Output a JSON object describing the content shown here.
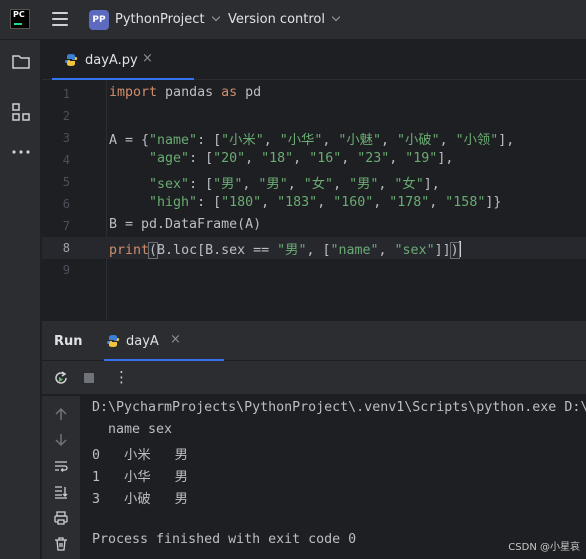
{
  "titlebar": {
    "app_logo": "PC",
    "project_badge": "PP",
    "project_name": "PythonProject",
    "version_control": "Version control"
  },
  "editor": {
    "tab_label": "dayA.py",
    "tab_close": "×",
    "lines": [
      {
        "number": "1",
        "text": "import pandas as pd"
      },
      {
        "number": "2",
        "text": ""
      },
      {
        "number": "3",
        "text": "A = {\"name\": [\"小米\", \"小华\", \"小魅\", \"小破\", \"小领\"],"
      },
      {
        "number": "4",
        "text": "     \"age\": [\"20\", \"18\", \"16\", \"23\", \"19\"],"
      },
      {
        "number": "5",
        "text": "     \"sex\": [\"男\", \"男\", \"女\", \"男\", \"女\"],"
      },
      {
        "number": "6",
        "text": "     \"high\": [\"180\", \"183\", \"160\", \"178\", \"158\"]}"
      },
      {
        "number": "7",
        "text": "B = pd.DataFrame(A)"
      },
      {
        "number": "8",
        "text": "print(B.loc[B.sex == \"男\", [\"name\", \"sex\"]])"
      },
      {
        "number": "9",
        "text": ""
      }
    ],
    "current_line": 8
  },
  "run": {
    "title": "Run",
    "tab_label": "dayA",
    "tab_close": "×",
    "more": "⋮",
    "console": [
      "D:\\PycharmProjects\\PythonProject\\.venv1\\Scripts\\python.exe D:\\",
      "  name sex",
      "0   小米   男",
      "1   小华   男",
      "3   小破   男",
      "",
      "Process finished with exit code 0"
    ]
  },
  "watermark": "CSDN @小星哀",
  "colors": {
    "accent": "#3574f0",
    "keyword": "#cf8e6d",
    "string": "#6aab73",
    "background": "#1e1f22",
    "panel": "#2b2d30"
  }
}
